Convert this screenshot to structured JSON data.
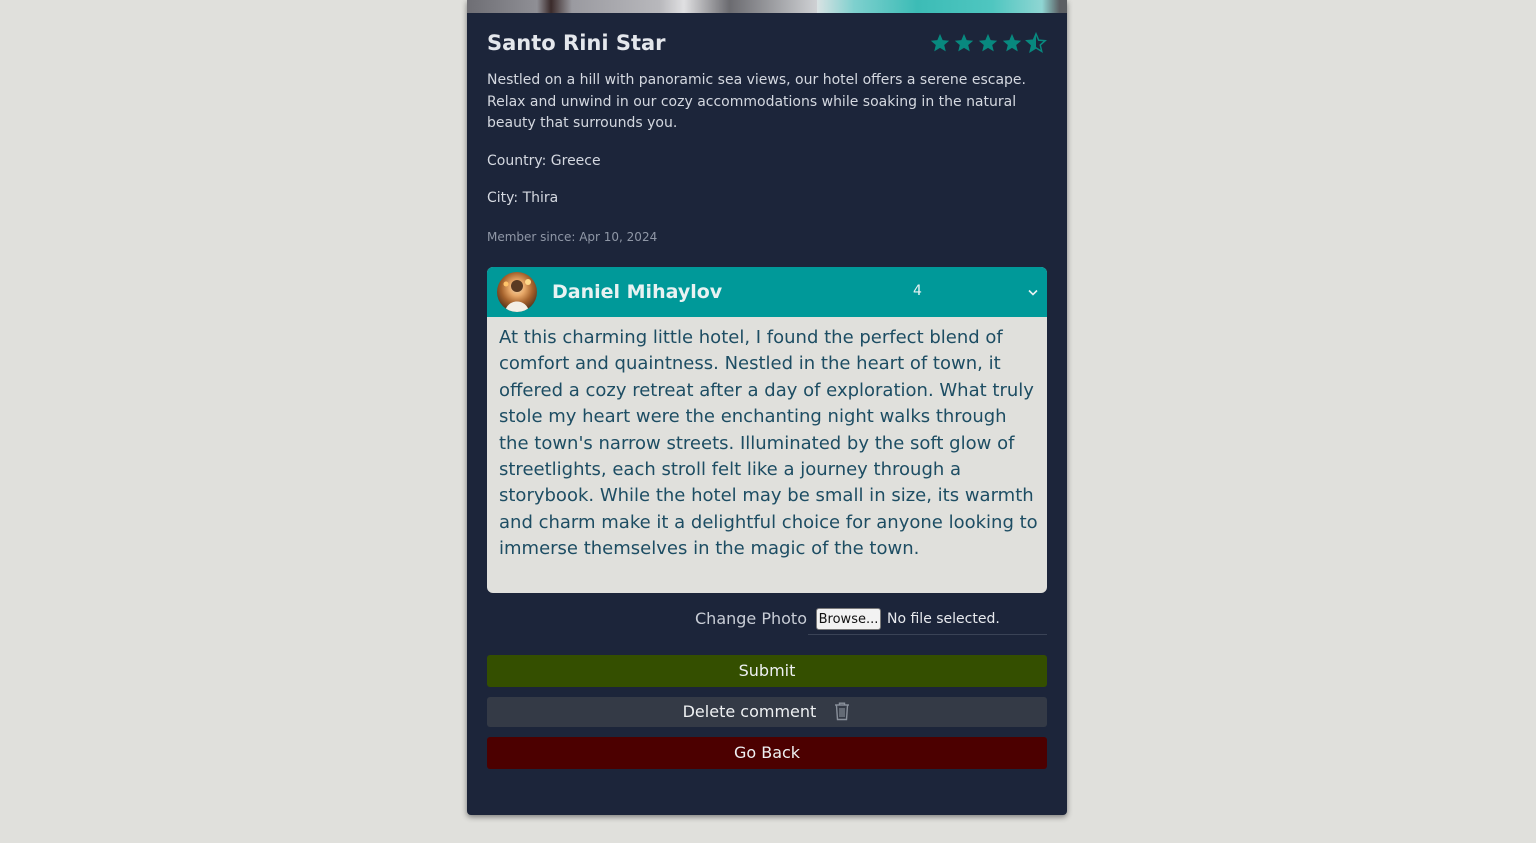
{
  "hotel": {
    "name": "Santo Rini Star",
    "rating": 4.5,
    "rating_max": 5,
    "description": "Nestled on a hill with panoramic sea views, our hotel offers a serene escape. Relax and unwind in our cozy accommodations while soaking in the natural beauty that surrounds you.",
    "country_text": "Country: Greece",
    "city_text": "City: Thira",
    "member_since": "Member since: Apr 10, 2024"
  },
  "review": {
    "author": "Daniel Mihaylov",
    "rating": "4",
    "text": "At this charming little hotel, I found the perfect blend of comfort and quaintness. Nestled in the heart of town, it offered a cozy retreat after a day of exploration. What truly stole my heart were the enchanting night walks through the town's narrow streets. Illuminated by the soft glow of streetlights, each stroll felt like a journey through a storybook. While the hotel may be small in size, its warmth and charm make it a delightful choice for anyone looking to immerse themselves in the magic of the town."
  },
  "photo": {
    "label": "Change Photo",
    "browse_label": "Browse...",
    "status": "No file selected."
  },
  "buttons": {
    "submit": "Submit",
    "delete": "Delete comment",
    "back": "Go Back"
  },
  "colors": {
    "accent": "#009999",
    "submit": "#344f00",
    "delete": "#343a46",
    "back": "#4c0000",
    "card": "#1c253a"
  },
  "icons": {
    "star": "star-icon",
    "chevron": "chevron-down-icon",
    "trash": "trash-icon"
  }
}
